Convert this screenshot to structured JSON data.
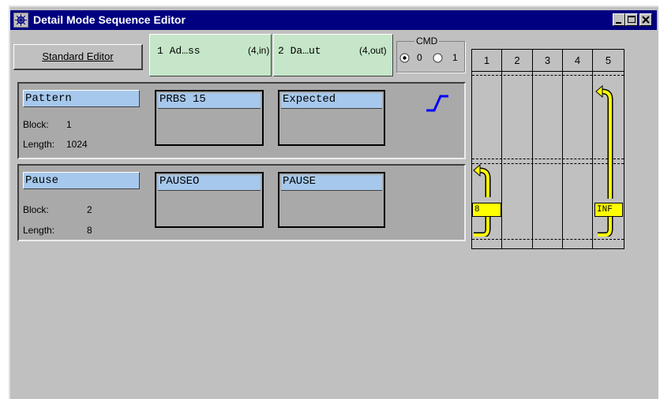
{
  "window": {
    "title": "Detail Mode Sequence Editor"
  },
  "toolbar": {
    "standard_editor_label": "Standard Editor",
    "ports": [
      {
        "name": "1 Ad…ss",
        "info": "(4,in)"
      },
      {
        "name": "2 Da…ut",
        "info": "(4,out)"
      }
    ],
    "cmd": {
      "label": "CMD",
      "options": [
        "0",
        "1"
      ],
      "selected": "0"
    }
  },
  "blocks": [
    {
      "name": "Pattern",
      "block_label": "Block:",
      "block_value": "1",
      "length_label": "Length:",
      "length_value": "1024",
      "slots": [
        "PRBS 15",
        "Expected"
      ]
    },
    {
      "name": "Pause",
      "block_label": "Block:",
      "block_value": "2",
      "length_label": "Length:",
      "length_value": "8",
      "slots": [
        "PAUSEO",
        "PAUSE"
      ]
    }
  ],
  "grid": {
    "columns": [
      "1",
      "2",
      "3",
      "4",
      "5"
    ],
    "loops": [
      {
        "column": "1",
        "label": "8"
      },
      {
        "column": "5",
        "label": "INF"
      }
    ]
  }
}
